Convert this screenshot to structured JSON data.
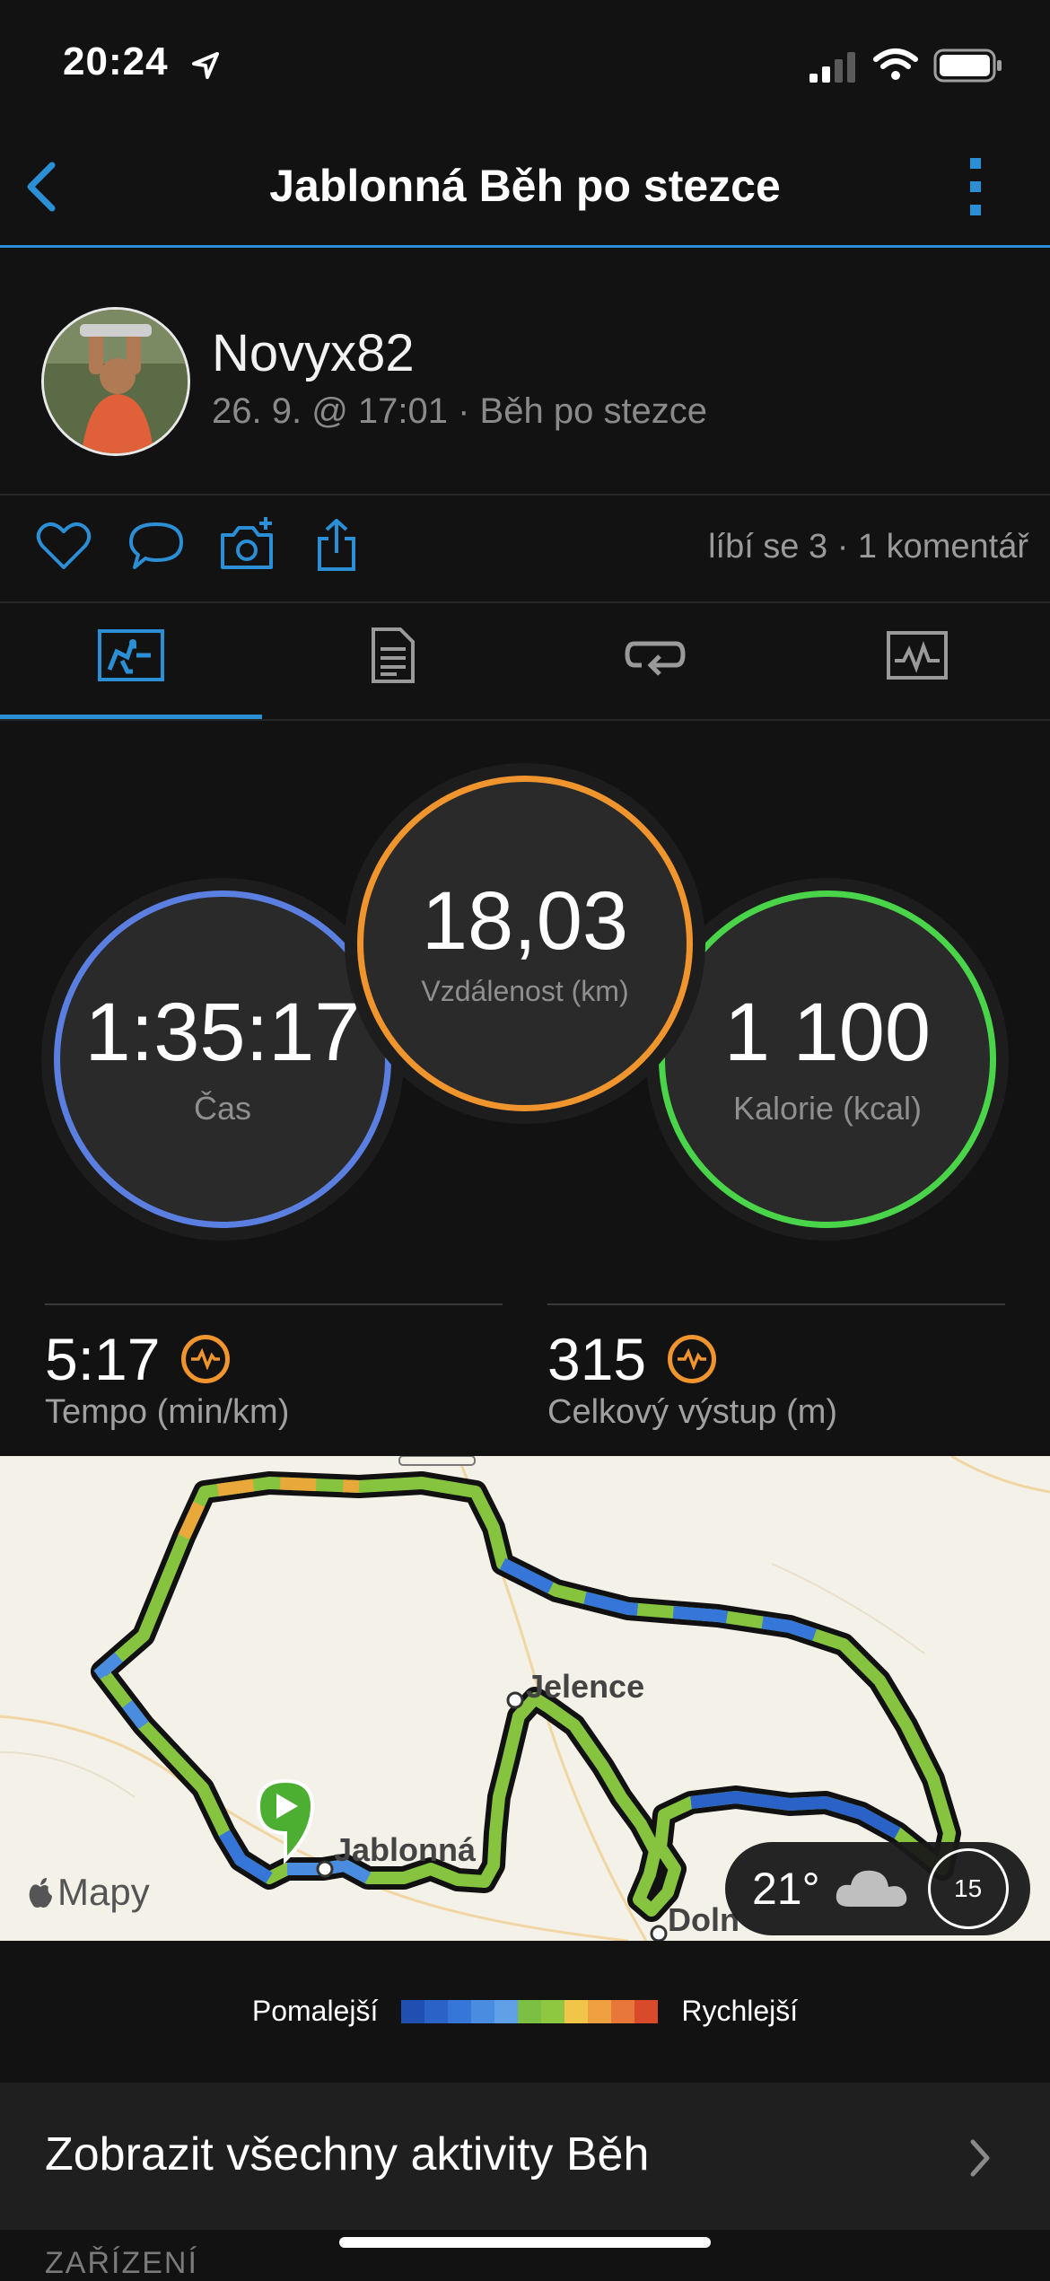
{
  "status_bar": {
    "time": "20:24"
  },
  "nav": {
    "title": "Jablonná Běh po stezce"
  },
  "profile": {
    "username": "Novyx82",
    "subtitle": "26. 9. @ 17:01 · Běh po stezce"
  },
  "social": {
    "counts": "líbí se 3 · 1 komentář"
  },
  "tabs": [
    {
      "icon": "stats-chart-icon",
      "active": true
    },
    {
      "icon": "details-document-icon",
      "active": false
    },
    {
      "icon": "laps-icon",
      "active": false
    },
    {
      "icon": "graphs-icon",
      "active": false
    }
  ],
  "circles": {
    "time": {
      "value": "1:35:17",
      "label": "Čas"
    },
    "distance": {
      "value": "18,03",
      "label": "Vzdálenost (km)"
    },
    "calories": {
      "value": "1 100",
      "label": "Kalorie (kcal)"
    }
  },
  "stats": {
    "pace": {
      "value": "5:17",
      "label": "Tempo (min/km)"
    },
    "ascent": {
      "value": "315",
      "label": "Celkový výstup (m)"
    }
  },
  "map": {
    "attribution": "Mapy",
    "places": {
      "jelence": "Jelence",
      "jablonna": "Jablonná",
      "dolni": "Doln"
    },
    "weather": {
      "temperature": "21°",
      "wind": "15"
    }
  },
  "legend": {
    "slower": "Pomalejší",
    "faster": "Rychlejší",
    "colors": [
      "#1f4fb0",
      "#2a62c8",
      "#3676d8",
      "#4a8ce0",
      "#5fa0e6",
      "#7cc043",
      "#8dc840",
      "#f0c54a",
      "#f0a040",
      "#e8783a",
      "#d84a2a"
    ]
  },
  "all_activities": {
    "label": "Zobrazit všechny aktivity Běh"
  },
  "section": {
    "label": "ZAŘÍZENÍ"
  },
  "colors": {
    "accent": "#2b8fd6",
    "time_ring": "#5b7fe0",
    "distance_ring": "#f0952e",
    "calories_ring": "#49d44a"
  }
}
